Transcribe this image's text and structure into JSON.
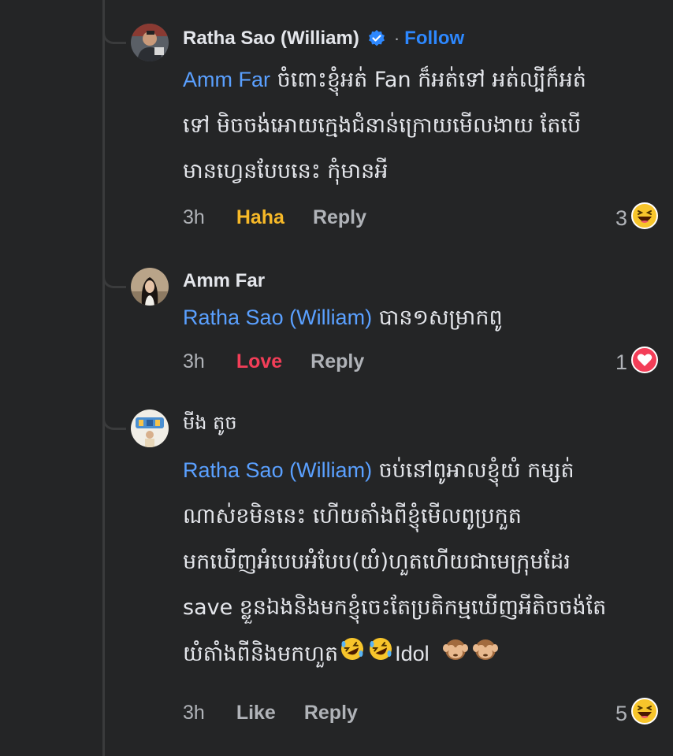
{
  "colors": {
    "background": "#242526",
    "text": "#e4e6eb",
    "muted": "#b0b3b8",
    "link": "#2d88ff",
    "mention": "#5aa0ff",
    "haha": "#f7b928",
    "love": "#f33e58"
  },
  "comments": [
    {
      "author": "Ratha Sao (William)",
      "verified_icon": "verified-badge-icon",
      "separator": "·",
      "follow_label": "Follow",
      "mention": "Amm Far",
      "text_lines": [
        " ចំពោះខ្ញុំអត់ Fan ក៏អត់ទៅ អត់ល្បីក៏អត់",
        "ទៅ មិចចង់អោយក្មេងជំនាន់ក្រោយមើលងាយ តែបើ",
        "មានហ្វេនបែបនេះ កុំមានអី"
      ],
      "time": "3h",
      "reaction_label": "Haha",
      "reply_label": "Reply",
      "reaction_count": "3",
      "reaction_icon": "haha-emoji-icon"
    },
    {
      "author": "Amm Far",
      "mention": "Ratha Sao (William)",
      "text": " បាន១សម្រាកពូ",
      "time": "3h",
      "reaction_label": "Love",
      "reply_label": "Reply",
      "reaction_count": "1",
      "reaction_icon": "love-heart-icon"
    },
    {
      "author": "មីង តូច",
      "mention": "Ratha Sao (William)",
      "text_lines": [
        " ចប់នៅពូអាលខ្ញុំយំ កម្សត់",
        "ណាស់ខមិននេះ ហើយតាំងពីខ្ញុំមើលពូប្រកួត",
        "មកឃើញអំបេបអំបែប(យំ)ហួតហើយជាមេក្រុមដែរ",
        "save ខ្លួនឯងនិងមកខ្ញុំចេះតែប្រតិកម្មឃើញអីតិចចង់តែ",
        "យំតាំងពីនិងមកហួត"
      ],
      "inline_text": "Idol",
      "inline_emoji_icons": [
        "rofl-emoji-icon",
        "rofl-emoji-icon",
        "see-no-evil-monkey-icon",
        "see-no-evil-monkey-icon"
      ],
      "time": "3h",
      "reaction_label": "Like",
      "reply_label": "Reply",
      "reaction_count": "5",
      "reaction_icon": "haha-emoji-icon"
    }
  ]
}
